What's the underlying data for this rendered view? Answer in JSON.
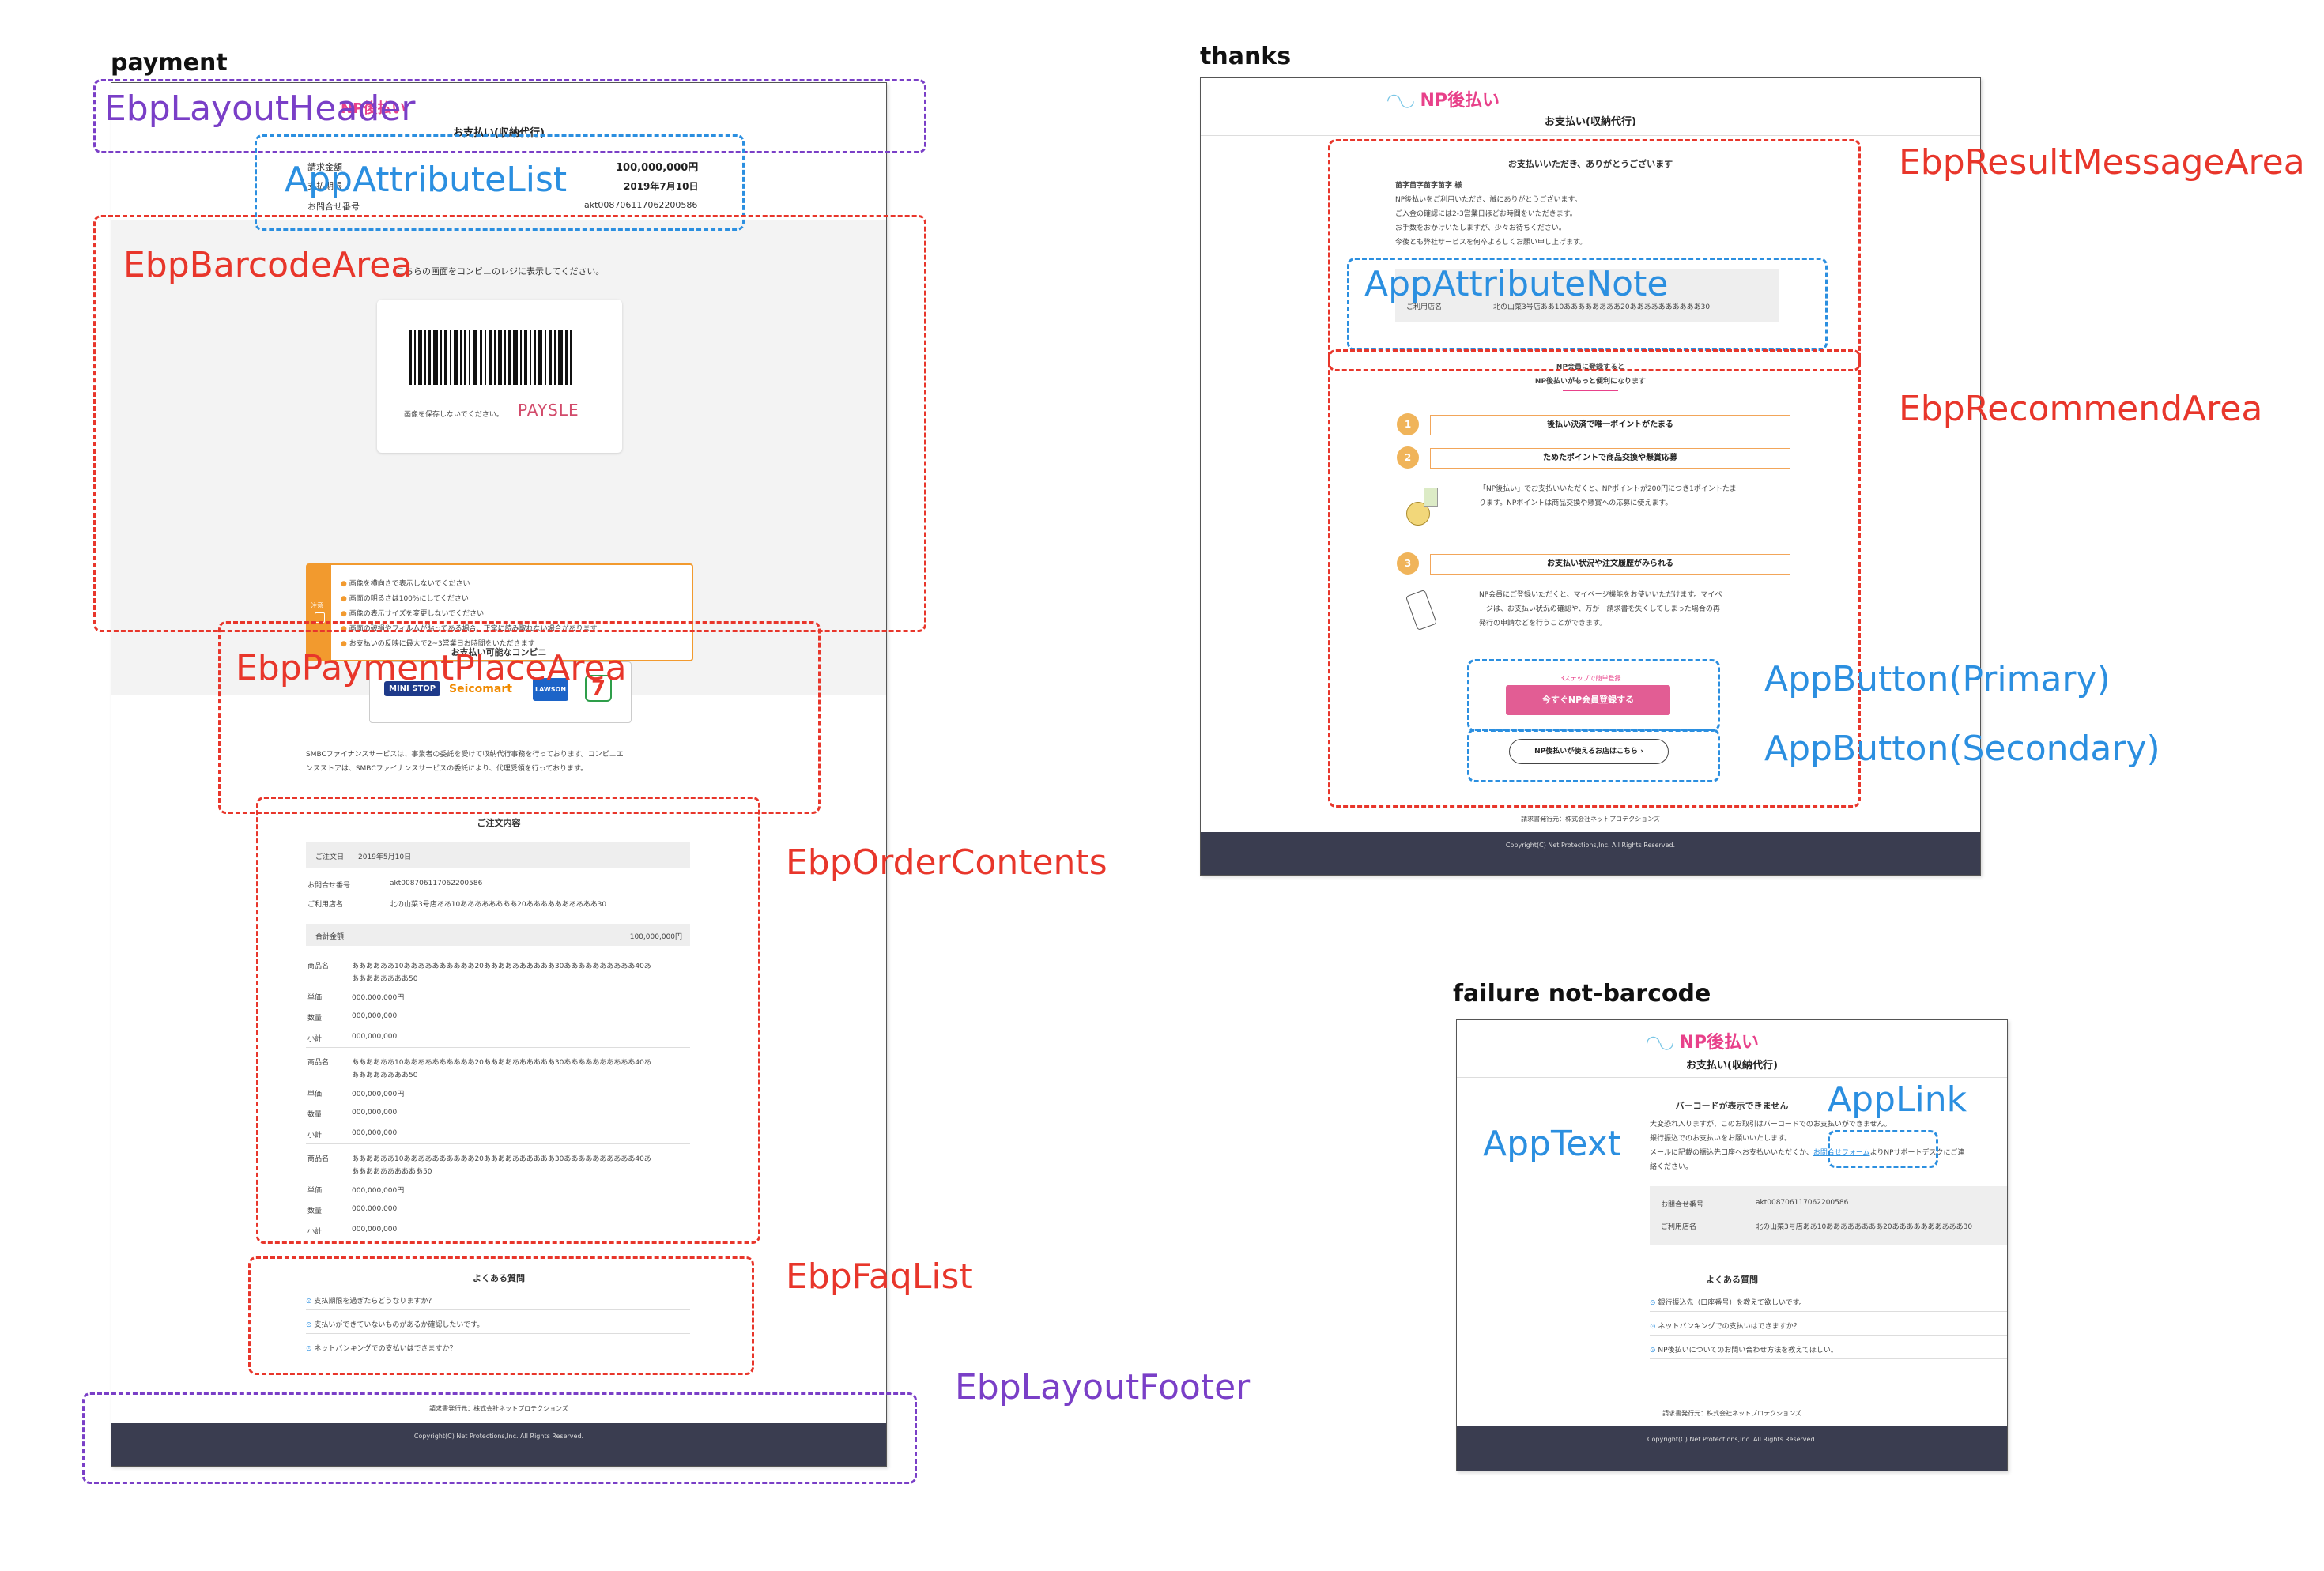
{
  "sections": {
    "payment": "payment",
    "thanks": "thanks",
    "failure": "failure not-barcode"
  },
  "colors": {
    "annotation_red": "#e8362b",
    "annotation_blue": "#2b8fe0",
    "annotation_purple": "#7a3fc7",
    "footer_bg": "#3a3d50",
    "brand_pink": "#e8418a",
    "warning_orange": "#f29a2e"
  },
  "labels": {
    "layout_header": "EbpLayoutHeader",
    "attribute_list": "AppAttributeList",
    "barcode_area": "EbpBarcodeArea",
    "payment_place_area": "EbpPaymentPlaceArea",
    "order_contents": "EbpOrderContents",
    "faq_list": "EbpFaqList",
    "layout_footer": "EbpLayoutFooter",
    "result_message_area": "EbpResultMessageArea",
    "attribute_note": "AppAttributeNote",
    "recommend_area": "EbpRecommendArea",
    "button_primary": "AppButton(Primary)",
    "button_secondary": "AppButton(Secondary)",
    "app_text": "AppText",
    "app_link": "AppLink"
  },
  "common": {
    "logo": "NP後払い",
    "page_heading": "お支払い(収納代行)",
    "issuer": "請求書発行元：株式会社ネットプロテクションズ",
    "copyright": "Copyright(C) Net Protections,Inc. All Rights Reserved."
  },
  "payment": {
    "attributes": [
      {
        "label": "請求金額",
        "value": "100,000,000円"
      },
      {
        "label": "支払期限",
        "value": "2019年7月10日"
      },
      {
        "label": "お問合せ番号",
        "value": "akt008706117062200586"
      }
    ],
    "barcode_instruction": "こちらの画面をコンビニのレジに表示してください。",
    "barcode_note": "画像を保存しないでください。",
    "barcode_brand": "PAYSLE",
    "warning_label": "注意",
    "warnings": [
      "画像を横向きで表示しないでください",
      "画面の明るさは100%にしてください",
      "画像の表示サイズを変更しないでください",
      "画面の破損やフィルムが貼ってある場合、正常に読み取れない場合があります",
      "お支払いの反映に最大で2~3営業日お時間をいただきます"
    ],
    "place_title": "お支払い可能なコンビニ",
    "stores": [
      "MINI STOP",
      "Seicomart",
      "LAWSON",
      "7"
    ],
    "place_note_1": "SMBCファイナンスサービスは、事業者の委託を受けて収納代行事務を行っております。コンビニエ",
    "place_note_2": "ンスストアは、SMBCファイナンスサービスの委託により、代理受領を行っております。",
    "order_title": "ご注文内容",
    "order_date_label": "ご注文日",
    "order_date": "2019年5月10日",
    "inquiry_label": "お問合せ番号",
    "inquiry_value": "akt008706117062200586",
    "shop_label": "ご利用店名",
    "shop_value": "北の山菜3号店ああ10ああああああああ20ああああああああああ30",
    "total_label": "合計金額",
    "total_value": "100,000,000円",
    "items": [
      {
        "name_label": "商品名",
        "name_1": "ああああああ10ああああああああああ20ああああああああああ30ああああああああああ40あ",
        "name_2": "ああああああああ50",
        "price_label": "単価",
        "price": "000,000,000円",
        "qty_label": "数量",
        "qty": "000,000,000",
        "sub_label": "小計",
        "sub": "000,000,000"
      },
      {
        "name_label": "商品名",
        "name_1": "ああああああ10ああああああああああ20ああああああああああ30ああああああああああ40あ",
        "name_2": "ああああああああ50",
        "price_label": "単価",
        "price": "000,000,000円",
        "qty_label": "数量",
        "qty": "000,000,000",
        "sub_label": "小計",
        "sub": "000,000,000"
      },
      {
        "name_label": "商品名",
        "name_1": "ああああああ10ああああああああああ20ああああああああああ30ああああああああああ40あ",
        "name_2": "ああああああああああ50",
        "price_label": "単価",
        "price": "000,000,000円",
        "qty_label": "数量",
        "qty": "000,000,000",
        "sub_label": "小計",
        "sub": "000,000,000"
      }
    ],
    "faq_title": "よくある質問",
    "faqs": [
      "支払期限を過ぎたらどうなりますか？",
      "支払いができていないものがあるか確認したいです。",
      "ネットバンキングでの支払いはできますか？"
    ]
  },
  "thanks": {
    "result_title": "お支払いいただき、ありがとうございます",
    "customer": "苗字苗字苗字苗字 様",
    "lines": [
      "NP後払いをご利用いただき、誠にありがとうございます。",
      "ご入金の確認には2-3営業日ほどお時間をいただきます。",
      "お手数をおかけいたしますが、少々お待ちください。",
      "今後とも弊社サービスを何卒よろしくお願い申し上げます。"
    ],
    "note_shop_label": "ご利用店名",
    "note_shop_value": "北の山菜3号店ああ10ああああああああ20ああああああああああ30",
    "recommend_title_1": "NP会員に登録すると",
    "recommend_title_2": "NP後払いがもっと便利になります",
    "features": [
      "後払い決済で唯一ポイントがたまる",
      "ためたポイントで商品交換や懸賞応募",
      "お支払い状況や注文履歴がみられる"
    ],
    "feature_desc_1": "「NP後払い」でお支払いいただくと、NPポイントが200円につき1ポイントたま",
    "feature_desc_2": "ります。NPポイントは商品交換や懸賞への応募に使えます。",
    "feature_desc_3": "NP会員にご登録いただくと、マイページ機能をお使いいただけます。マイペ",
    "feature_desc_4": "ージは、お支払い状況の確認や、万が一請求書を失くしてしまった場合の再",
    "feature_desc_5": "発行の申請などを行うことができます。",
    "primary_caption": "3ステップで簡単登録",
    "primary_button": "今すぐNP会員登録する",
    "secondary_button": "NP後払いが使えるお店はこちら"
  },
  "failure": {
    "title": "バーコードが表示できません",
    "line_1": "大変恐れ入りますが、このお取引はバーコードでのお支払いができません。",
    "line_2": "銀行振込でのお支払いをお願いいたします。",
    "line_3_pre": "メールに記載の振込先口座へお支払いいただくか、",
    "link": "お問合せフォーム",
    "line_3_post": "よりNPサポートデスクにご連",
    "line_4": "絡ください。",
    "inquiry_label": "お問合せ番号",
    "inquiry_value": "akt008706117062200586",
    "shop_label": "ご利用店名",
    "shop_value": "北の山菜3号店ああ10ああああああああ20ああああああああああ30",
    "faq_title": "よくある質問",
    "faqs": [
      "銀行振込先（口座番号）を教えて欲しいです。",
      "ネットバンキングでの支払いはできますか？",
      "NP後払いについてのお問い合わせ方法を教えてほしい。"
    ]
  }
}
